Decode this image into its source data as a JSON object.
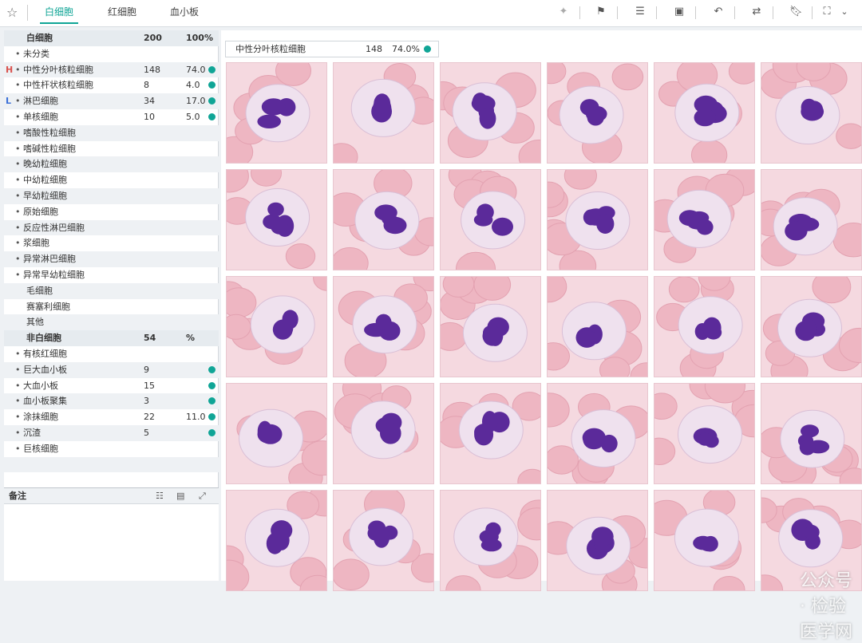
{
  "tabs": [
    {
      "label": "白细胞"
    },
    {
      "label": "红细胞"
    },
    {
      "label": "血小板"
    }
  ],
  "toolbar_icons": [
    "sparkle-icon",
    "flag-icon",
    "align-icon",
    "book-icon",
    "undo-icon",
    "swap-icon",
    "bookmark-icon",
    "focus-icon",
    "chevron-down-icon"
  ],
  "wbc": {
    "title": "白细胞",
    "count": "200",
    "pct": "100%",
    "rows": [
      {
        "mark": "",
        "name": "未分类",
        "count": "",
        "pct": "",
        "dot": false
      },
      {
        "mark": "H",
        "name": "中性分叶核粒细胞",
        "count": "148",
        "pct": "74.0",
        "dot": true
      },
      {
        "mark": "",
        "name": "中性杆状核粒细胞",
        "count": "8",
        "pct": "4.0",
        "dot": true
      },
      {
        "mark": "L",
        "name": "淋巴细胞",
        "count": "34",
        "pct": "17.0",
        "dot": true
      },
      {
        "mark": "",
        "name": "单核细胞",
        "count": "10",
        "pct": "5.0",
        "dot": true
      },
      {
        "mark": "",
        "name": "嗜酸性粒细胞",
        "count": "",
        "pct": "",
        "dot": false
      },
      {
        "mark": "",
        "name": "嗜碱性粒细胞",
        "count": "",
        "pct": "",
        "dot": false
      },
      {
        "mark": "",
        "name": "晚幼粒细胞",
        "count": "",
        "pct": "",
        "dot": false
      },
      {
        "mark": "",
        "name": "中幼粒细胞",
        "count": "",
        "pct": "",
        "dot": false
      },
      {
        "mark": "",
        "name": "早幼粒细胞",
        "count": "",
        "pct": "",
        "dot": false
      },
      {
        "mark": "",
        "name": "原始细胞",
        "count": "",
        "pct": "",
        "dot": false
      },
      {
        "mark": "",
        "name": "反应性淋巴细胞",
        "count": "",
        "pct": "",
        "dot": false
      },
      {
        "mark": "",
        "name": "浆细胞",
        "count": "",
        "pct": "",
        "dot": false
      },
      {
        "mark": "",
        "name": "异常淋巴细胞",
        "count": "",
        "pct": "",
        "dot": false
      },
      {
        "mark": "",
        "name": "异常早幼粒细胞",
        "count": "",
        "pct": "",
        "dot": false
      },
      {
        "mark": "",
        "name": "毛细胞",
        "count": "",
        "pct": "",
        "dot": false,
        "nobullet": true
      },
      {
        "mark": "",
        "name": "赛塞利细胞",
        "count": "",
        "pct": "",
        "dot": false,
        "nobullet": true
      },
      {
        "mark": "",
        "name": "其他",
        "count": "",
        "pct": "",
        "dot": false,
        "nobullet": true
      }
    ]
  },
  "nonwbc": {
    "title": "非白细胞",
    "count": "54",
    "pct": "%",
    "rows": [
      {
        "name": "有核红细胞",
        "count": "",
        "pct": "",
        "dot": false
      },
      {
        "name": "巨大血小板",
        "count": "9",
        "pct": "",
        "dot": true
      },
      {
        "name": "大血小板",
        "count": "15",
        "pct": "",
        "dot": true
      },
      {
        "name": "血小板聚集",
        "count": "3",
        "pct": "",
        "dot": true
      },
      {
        "name": "涂抹细胞",
        "count": "22",
        "pct": "11.0",
        "dot": true
      },
      {
        "name": "沉渣",
        "count": "5",
        "pct": "",
        "dot": true
      },
      {
        "name": "巨核细胞",
        "count": "",
        "pct": "",
        "dot": false
      }
    ]
  },
  "notes": {
    "title": "备注"
  },
  "selected": {
    "name": "中性分叶核粒细胞",
    "count": "148",
    "pct": "74.0%"
  },
  "watermark": "公众号 · 检验医学网"
}
